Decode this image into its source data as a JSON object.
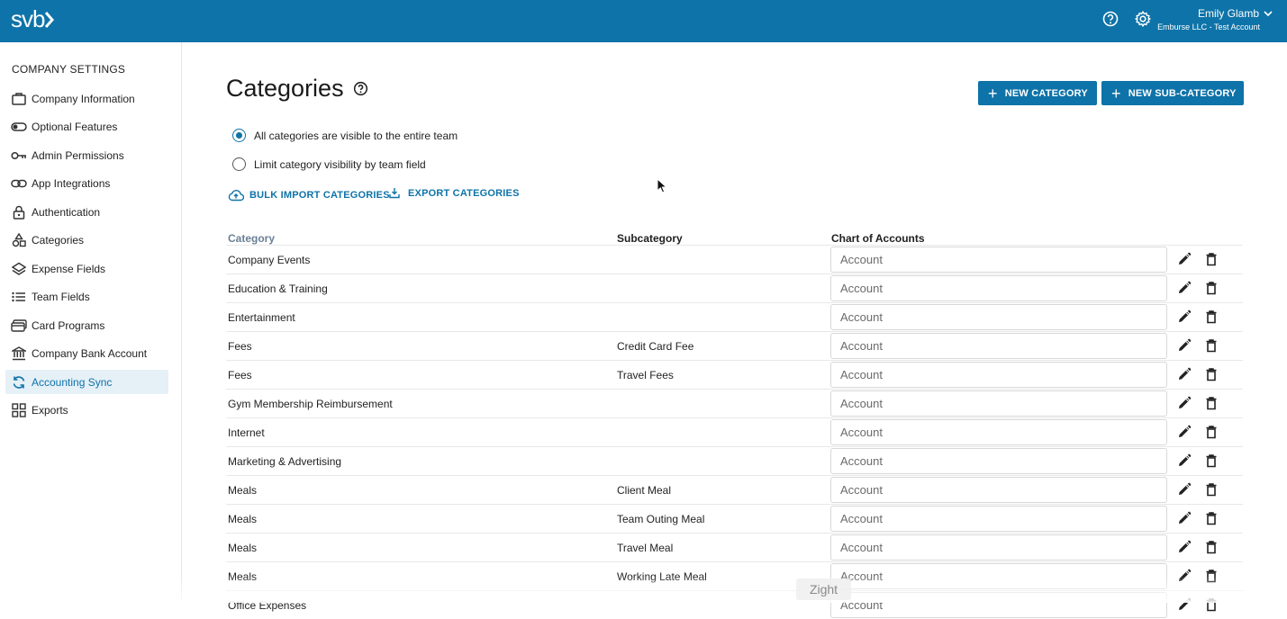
{
  "header": {
    "logo": "svb",
    "user_name": "Emily Glamb",
    "user_org": "Emburse LLC - Test Account",
    "help_icon": "help-circle-icon",
    "settings_icon": "gear-icon"
  },
  "sidebar": {
    "title": "COMPANY SETTINGS",
    "items": [
      {
        "label": "Company Information",
        "icon": "building-icon"
      },
      {
        "label": "Optional Features",
        "icon": "toggle-icon"
      },
      {
        "label": "Admin Permissions",
        "icon": "key-icon"
      },
      {
        "label": "App Integrations",
        "icon": "link-icon"
      },
      {
        "label": "Authentication",
        "icon": "lock-icon"
      },
      {
        "label": "Categories",
        "icon": "shapes-icon"
      },
      {
        "label": "Expense Fields",
        "icon": "layers-icon"
      },
      {
        "label": "Team Fields",
        "icon": "list-icon"
      },
      {
        "label": "Card Programs",
        "icon": "cards-icon"
      },
      {
        "label": "Company Bank Account",
        "icon": "bank-icon"
      },
      {
        "label": "Accounting Sync",
        "icon": "sync-icon",
        "active": true
      },
      {
        "label": "Exports",
        "icon": "grid-icon"
      }
    ]
  },
  "main": {
    "title": "Categories",
    "new_category_label": "NEW CATEGORY",
    "new_subcategory_label": "NEW SUB-CATEGORY",
    "visibility_options": [
      {
        "label": "All categories are visible to the entire team",
        "checked": true
      },
      {
        "label": "Limit category visibility by team field",
        "checked": false
      }
    ],
    "bulk_import_label": "BULK IMPORT CATEGORIES",
    "export_label": "EXPORT CATEGORIES",
    "columns": {
      "category": "Category",
      "subcategory": "Subcategory",
      "chart_of_accounts": "Chart of Accounts"
    },
    "account_placeholder": "Account",
    "rows": [
      {
        "category": "Company Events",
        "subcategory": ""
      },
      {
        "category": "Education & Training",
        "subcategory": ""
      },
      {
        "category": "Entertainment",
        "subcategory": ""
      },
      {
        "category": "Fees",
        "subcategory": "Credit Card Fee"
      },
      {
        "category": "Fees",
        "subcategory": "Travel Fees"
      },
      {
        "category": "Gym Membership Reimbursement",
        "subcategory": ""
      },
      {
        "category": "Internet",
        "subcategory": ""
      },
      {
        "category": "Marketing & Advertising",
        "subcategory": ""
      },
      {
        "category": "Meals",
        "subcategory": "Client Meal"
      },
      {
        "category": "Meals",
        "subcategory": "Team Outing Meal"
      },
      {
        "category": "Meals",
        "subcategory": "Travel Meal"
      },
      {
        "category": "Meals",
        "subcategory": "Working Late Meal"
      },
      {
        "category": "Office Expenses",
        "subcategory": ""
      }
    ]
  },
  "watermark": "Zight",
  "colors": {
    "brand": "#0e73a8",
    "active_bg": "#e5f0f7",
    "category_header": "#6b7f95"
  }
}
